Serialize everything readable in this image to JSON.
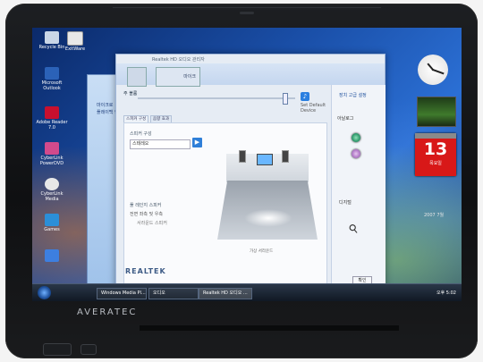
{
  "device": {
    "brand": "AVERATEC"
  },
  "desktop": {
    "icons": [
      {
        "label": "Recycle Bin"
      },
      {
        "label": "ExitWare"
      },
      {
        "label": "Microsoft Outlook"
      },
      {
        "label": "Adobe Reader 7.0"
      },
      {
        "label": "CyberLink PowerDVD"
      },
      {
        "label": "CyberLink Media"
      },
      {
        "label": "Games"
      }
    ],
    "sidepanel_lines": [
      "마이크로",
      "플레이백 항목"
    ]
  },
  "gadgets": {
    "calendar_day": "13",
    "calendar_weekday": "목요일",
    "calendar_header": "2007 7월"
  },
  "dialog": {
    "title": "Realtek HD 오디오 관리자",
    "device_mic_label": "마이크",
    "volume_label": "주 볼륨",
    "set_default_label": "Set Default Device",
    "tabs": [
      "스피커 구성",
      "음향 효과"
    ],
    "config_label": "스피커 구성",
    "config_value": "스테레오",
    "fullrange_label": "풀 레인지 스피커",
    "check_1": "전면 좌측 및 우측",
    "check_2": "서라운드 스피커",
    "room_caption": "가상 서라운드",
    "right_top_link": "장치 고급 설정",
    "connector_label": "아날로그",
    "analog_label": "디지털",
    "logo": "REALTEK",
    "confirm_label": "확인"
  },
  "taskbar": {
    "tasks": [
      "Windows Media Pl...",
      "오디오",
      "Realtek HD 오디오 ..."
    ],
    "clock": "오후 5:02"
  },
  "colors": {
    "accent_blue": "#2f7fd8",
    "jack_green": "#1f8f60",
    "jack_pink": "#a66bbf",
    "calendar_red": "#d81818"
  },
  "state": {
    "volume_level": 0.95
  }
}
